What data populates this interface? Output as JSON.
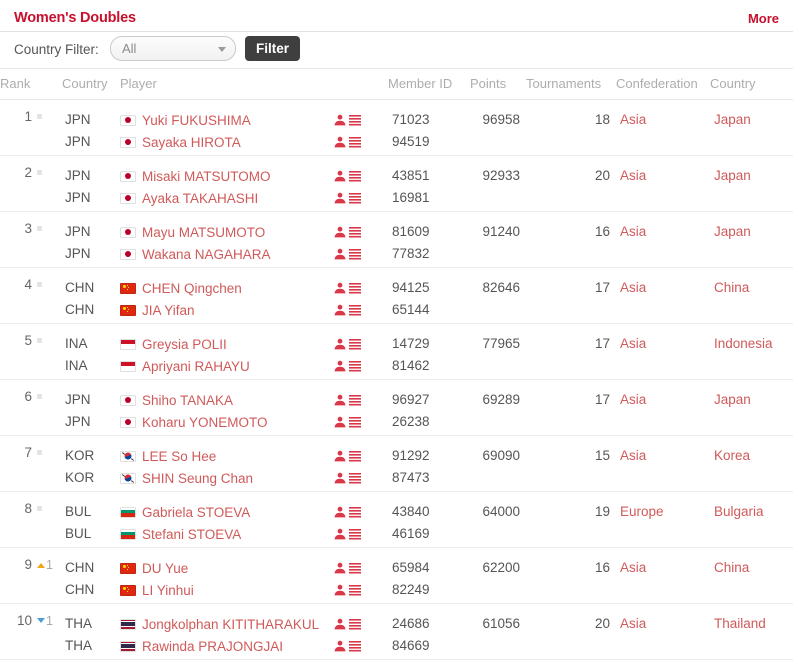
{
  "header": {
    "title": "Women's Doubles",
    "more_label": "More",
    "title_color": "#c8102e"
  },
  "filter": {
    "label": "Country Filter:",
    "select_value": "All",
    "select_placeholder": "All",
    "button_label": "Filter"
  },
  "table": {
    "columns": [
      "Rank",
      "Country",
      "Player",
      "",
      "Member ID",
      "Points",
      "Tournaments",
      "Confederation",
      "Country"
    ],
    "rows": [
      {
        "rank": "1",
        "change_type": "none",
        "change_value": "",
        "points": "96958",
        "tournaments": "18",
        "confederation": "Asia",
        "country": "Japan",
        "players": [
          {
            "code": "JPN",
            "flag": "jpn",
            "name": "Yuki FUKUSHIMA",
            "member_id": "71023"
          },
          {
            "code": "JPN",
            "flag": "jpn",
            "name": "Sayaka HIROTA",
            "member_id": "94519"
          }
        ]
      },
      {
        "rank": "2",
        "change_type": "none",
        "change_value": "",
        "points": "92933",
        "tournaments": "20",
        "confederation": "Asia",
        "country": "Japan",
        "players": [
          {
            "code": "JPN",
            "flag": "jpn",
            "name": "Misaki MATSUTOMO",
            "member_id": "43851"
          },
          {
            "code": "JPN",
            "flag": "jpn",
            "name": "Ayaka TAKAHASHI",
            "member_id": "16981"
          }
        ]
      },
      {
        "rank": "3",
        "change_type": "none",
        "change_value": "",
        "points": "91240",
        "tournaments": "16",
        "confederation": "Asia",
        "country": "Japan",
        "players": [
          {
            "code": "JPN",
            "flag": "jpn",
            "name": "Mayu MATSUMOTO",
            "member_id": "81609"
          },
          {
            "code": "JPN",
            "flag": "jpn",
            "name": "Wakana NAGAHARA",
            "member_id": "77832"
          }
        ]
      },
      {
        "rank": "4",
        "change_type": "none",
        "change_value": "",
        "points": "82646",
        "tournaments": "17",
        "confederation": "Asia",
        "country": "China",
        "players": [
          {
            "code": "CHN",
            "flag": "chn",
            "name": "CHEN Qingchen",
            "member_id": "94125"
          },
          {
            "code": "CHN",
            "flag": "chn",
            "name": "JIA Yifan",
            "member_id": "65144"
          }
        ]
      },
      {
        "rank": "5",
        "change_type": "none",
        "change_value": "",
        "points": "77965",
        "tournaments": "17",
        "confederation": "Asia",
        "country": "Indonesia",
        "players": [
          {
            "code": "INA",
            "flag": "ina",
            "name": "Greysia POLII",
            "member_id": "14729"
          },
          {
            "code": "INA",
            "flag": "ina",
            "name": "Apriyani RAHAYU",
            "member_id": "81462"
          }
        ]
      },
      {
        "rank": "6",
        "change_type": "none",
        "change_value": "",
        "points": "69289",
        "tournaments": "17",
        "confederation": "Asia",
        "country": "Japan",
        "players": [
          {
            "code": "JPN",
            "flag": "jpn",
            "name": "Shiho TANAKA",
            "member_id": "96927"
          },
          {
            "code": "JPN",
            "flag": "jpn",
            "name": "Koharu YONEMOTO",
            "member_id": "26238"
          }
        ]
      },
      {
        "rank": "7",
        "change_type": "none",
        "change_value": "",
        "points": "69090",
        "tournaments": "15",
        "confederation": "Asia",
        "country": "Korea",
        "players": [
          {
            "code": "KOR",
            "flag": "kor",
            "name": "LEE So Hee",
            "member_id": "91292"
          },
          {
            "code": "KOR",
            "flag": "kor",
            "name": "SHIN Seung Chan",
            "member_id": "87473"
          }
        ]
      },
      {
        "rank": "8",
        "change_type": "none",
        "change_value": "",
        "points": "64000",
        "tournaments": "19",
        "confederation": "Europe",
        "country": "Bulgaria",
        "players": [
          {
            "code": "BUL",
            "flag": "bul",
            "name": "Gabriela STOEVA",
            "member_id": "43840"
          },
          {
            "code": "BUL",
            "flag": "bul",
            "name": "Stefani STOEVA",
            "member_id": "46169"
          }
        ]
      },
      {
        "rank": "9",
        "change_type": "up",
        "change_value": "1",
        "points": "62200",
        "tournaments": "16",
        "confederation": "Asia",
        "country": "China",
        "players": [
          {
            "code": "CHN",
            "flag": "chn",
            "name": "DU Yue",
            "member_id": "65984"
          },
          {
            "code": "CHN",
            "flag": "chn",
            "name": "LI Yinhui",
            "member_id": "82249"
          }
        ]
      },
      {
        "rank": "10",
        "change_type": "down",
        "change_value": "1",
        "points": "61056",
        "tournaments": "20",
        "confederation": "Asia",
        "country": "Thailand",
        "players": [
          {
            "code": "THA",
            "flag": "tha",
            "name": "Jongkolphan KITITHARAKUL",
            "member_id": "24686"
          },
          {
            "code": "THA",
            "flag": "tha",
            "name": "Rawinda PRAJONGJAI",
            "member_id": "84669"
          }
        ]
      }
    ]
  },
  "icons": {
    "profile": "person-icon",
    "details": "list-icon"
  },
  "colors": {
    "brand_red": "#c8102e",
    "link_red": "#d05a5a",
    "rank_up": "#f0a714",
    "rank_down": "#4c9fd4"
  }
}
